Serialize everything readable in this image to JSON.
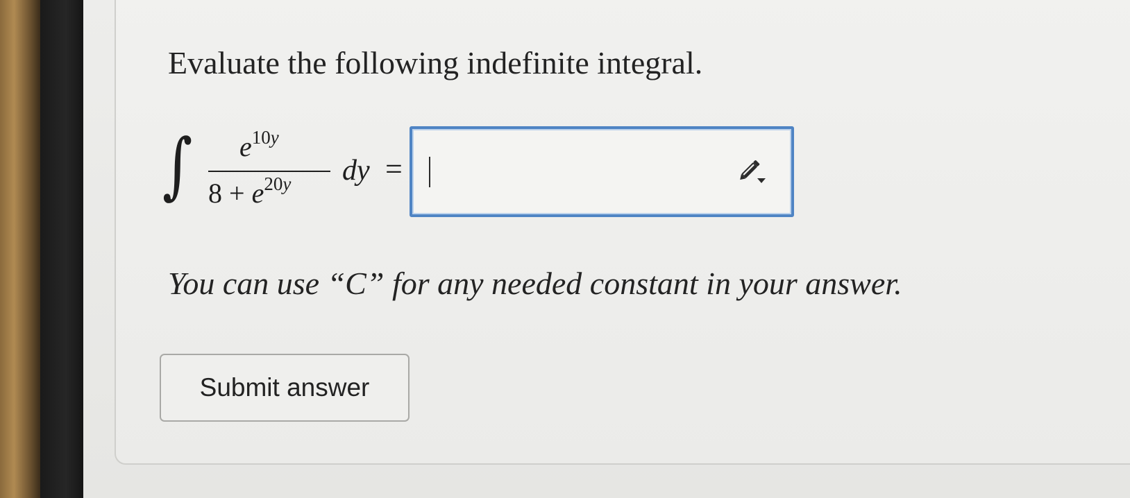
{
  "question": {
    "title": "Evaluate the following indefinite integral."
  },
  "integral": {
    "sign": "∫",
    "numerator": {
      "base": "e",
      "exponent_number": "10",
      "exponent_var": "y"
    },
    "denominator": {
      "constant": "8",
      "operator": "+",
      "base": "e",
      "exponent_number": "20",
      "exponent_var": "y"
    },
    "differential": "dy",
    "equals": "="
  },
  "answer_input": {
    "value": "",
    "tool_icon": "pencil-dropdown-icon",
    "focus_color": "#4f84c4"
  },
  "hint": "You can use “C” for any needed constant in your answer.",
  "submit": {
    "label": "Submit answer"
  }
}
